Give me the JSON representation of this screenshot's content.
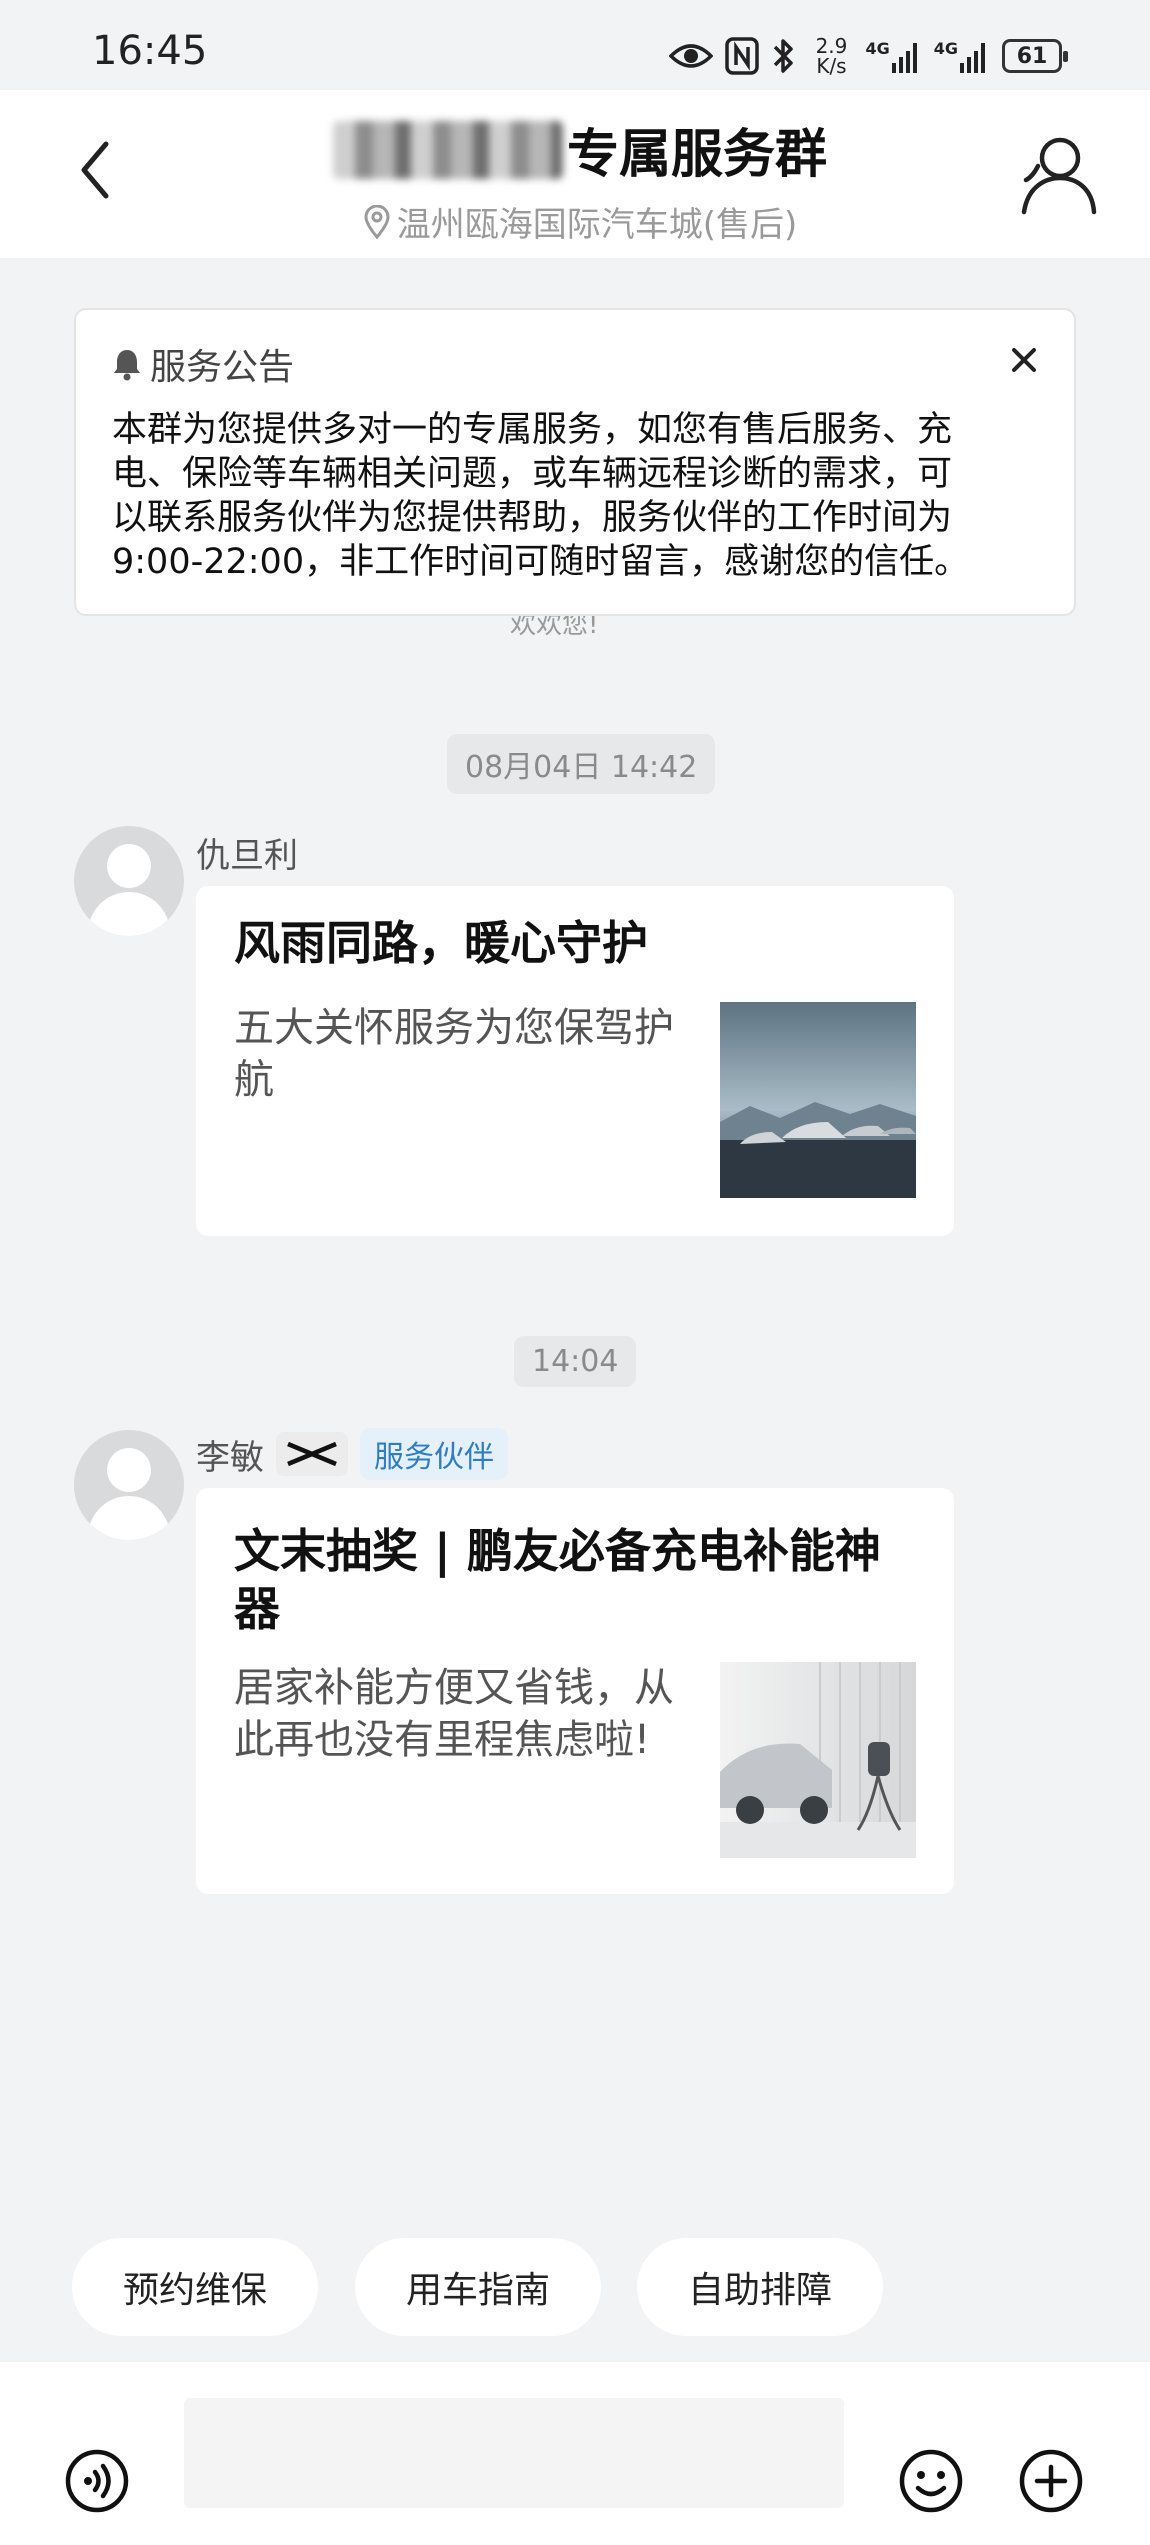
{
  "status_bar": {
    "time": "16:45",
    "net_speed_value": "2.9",
    "net_speed_unit": "K/s",
    "signal_1": "4G",
    "signal_2": "4G",
    "battery": "61"
  },
  "header": {
    "title_suffix": "专属服务群",
    "subtitle": "温州瓯海国际汽车城(售后)"
  },
  "notice": {
    "title": "服务公告",
    "body_lines": [
      "本群为您提供多对一的专属服务，如您有售后服务、充",
      "电、保险等车辆相关问题，或车辆远程诊断的需求，可",
      "以联系服务伙伴为您提供帮助，服务伙伴的工作时间为",
      "9:00-22:00，非工作时间可随时留言，感谢您的信任。"
    ]
  },
  "faded_text": "欢欢您!",
  "messages": [
    {
      "timestamp": "08月04日 14:42",
      "sender": "仇旦利",
      "card_title": "风雨同路，暖心守护",
      "card_desc": "五大关怀服务为您保驾护航",
      "thumb_icon": "suvs-landscape-image"
    },
    {
      "timestamp": "14:04",
      "sender": "李敏",
      "badge": "服务伙伴",
      "card_title": "文末抽奖 | 鹏友必备充电补能神器",
      "card_desc": "居家补能方便又省钱，从此再也没有里程焦虑啦!",
      "thumb_icon": "suv-charger-image"
    }
  ],
  "quick_actions": [
    "预约维保",
    "用车指南",
    "自助排障"
  ],
  "input": {
    "placeholder": ""
  },
  "colors": {
    "background": "#f2f3f5",
    "partner_badge_text": "#2f7ec1",
    "partner_badge_bg": "#e5f0fa"
  }
}
